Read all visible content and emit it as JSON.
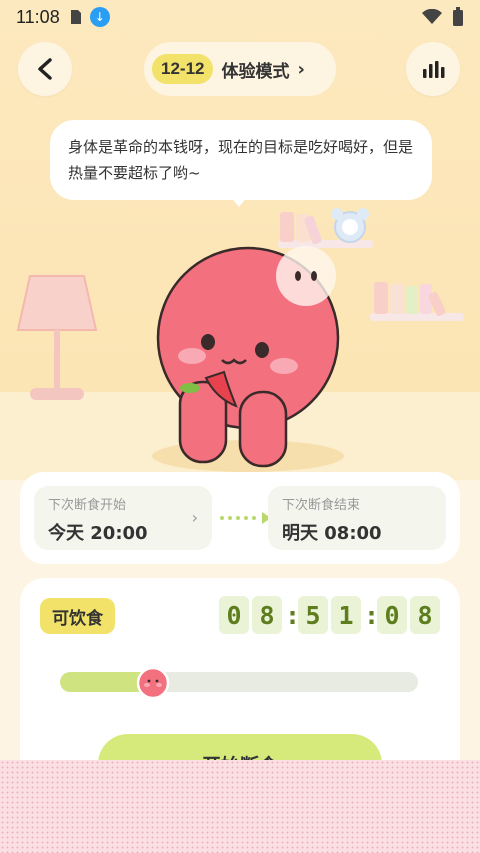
{
  "status_bar": {
    "time": "11:08",
    "icons": [
      "sim-card-icon",
      "download-icon",
      "wifi-icon",
      "battery-icon"
    ]
  },
  "header": {
    "back_icon": "back-arrow-icon",
    "mode_badge": "12-12",
    "mode_label": "体验模式",
    "mode_chevron": "›",
    "stats_icon": "bar-chart-icon"
  },
  "speech_bubble": {
    "text": "身体是革命的本钱呀，现在的目标是吃好喝好，但是热量不要超标了哟~"
  },
  "fasting_times": {
    "next_start": {
      "label": "下次断食开始",
      "value": "今天 20:00",
      "chevron": "›"
    },
    "next_end": {
      "label": "下次断食结束",
      "value": "明天 08:00"
    }
  },
  "timer_card": {
    "state_label": "可饮食",
    "timer": {
      "h1": "0",
      "h2": "8",
      "m1": "5",
      "m2": "1",
      "s1": "0",
      "s2": "8",
      "sep": ":"
    },
    "progress_fraction": 0.26,
    "button_label": "开始断食"
  },
  "colors": {
    "accent_yellow": "#f2e26a",
    "accent_green": "#d6ea7c",
    "timer_text": "#5d7d1e",
    "character": "#f06b7a"
  }
}
